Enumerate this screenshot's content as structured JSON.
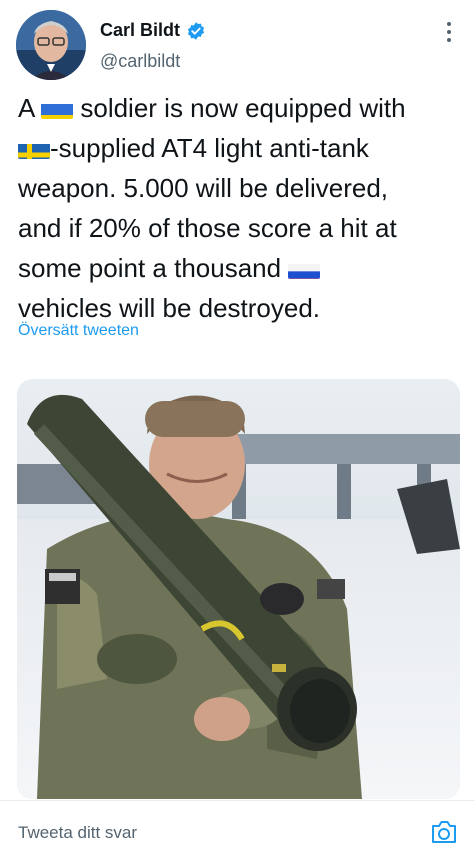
{
  "tweet": {
    "author_name": "Carl Bildt",
    "handle": "@carlbildt",
    "text_parts": {
      "p1": "A ",
      "p2": " soldier is now equipped with\n",
      "p3": "-supplied AT4 light anti-tank\nweapon. 5.000 will be delivered,\nand if 20% of those score a hit at\nsome point a thousand ",
      "p4": "\nvehicles will be destroyed."
    },
    "flags": [
      "ukraine-flag",
      "sweden-flag",
      "russia-flag"
    ],
    "translate_label": "Översätt tweeten"
  },
  "reply": {
    "placeholder": "Tweeta ditt svar"
  },
  "colors": {
    "accent": "#1d9bf0",
    "text": "#0f1419",
    "muted": "#536471"
  }
}
